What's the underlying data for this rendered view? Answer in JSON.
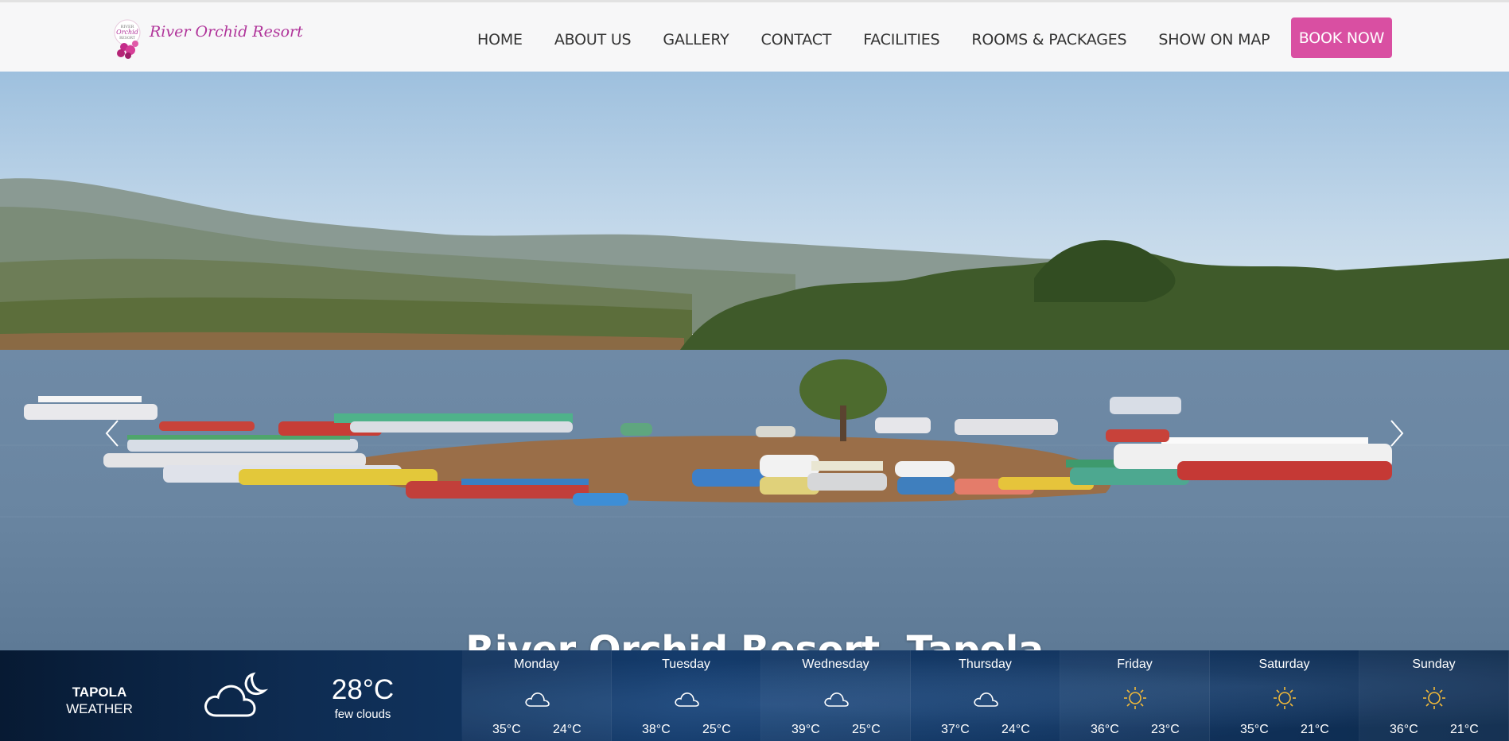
{
  "brand": {
    "logo_text": "River Orchid Resort",
    "logo_badge_lines": [
      "RIVER",
      "Orchid",
      "RESORT"
    ],
    "accent_color": "#d94fa2",
    "logo_color": "#b0349a"
  },
  "nav": {
    "items": [
      {
        "label": "HOME"
      },
      {
        "label": "ABOUT US"
      },
      {
        "label": "GALLERY"
      },
      {
        "label": "CONTACT"
      },
      {
        "label": "FACILITIES"
      },
      {
        "label": "ROOMS & PACKAGES"
      },
      {
        "label": "SHOW ON MAP"
      }
    ],
    "book_label": "BOOK NOW"
  },
  "hero": {
    "title": "River Orchid Resort, Tapola",
    "prev_icon": "chevron-left-icon",
    "next_icon": "chevron-right-icon"
  },
  "weather": {
    "city": "TAPOLA",
    "label": "WEATHER",
    "current_temp": "28°C",
    "current_desc": "few clouds",
    "current_icon": "cloud-moon-icon",
    "days": [
      {
        "name": "Monday",
        "icon": "cloud-icon",
        "hi": "35°C",
        "lo": "24°C"
      },
      {
        "name": "Tuesday",
        "icon": "cloud-icon",
        "hi": "38°C",
        "lo": "25°C"
      },
      {
        "name": "Wednesday",
        "icon": "cloud-icon",
        "hi": "39°C",
        "lo": "25°C"
      },
      {
        "name": "Thursday",
        "icon": "cloud-icon",
        "hi": "37°C",
        "lo": "24°C"
      },
      {
        "name": "Friday",
        "icon": "sun-icon",
        "hi": "36°C",
        "lo": "23°C"
      },
      {
        "name": "Saturday",
        "icon": "sun-icon",
        "hi": "35°C",
        "lo": "21°C"
      },
      {
        "name": "Sunday",
        "icon": "sun-icon",
        "hi": "36°C",
        "lo": "21°C"
      }
    ]
  }
}
